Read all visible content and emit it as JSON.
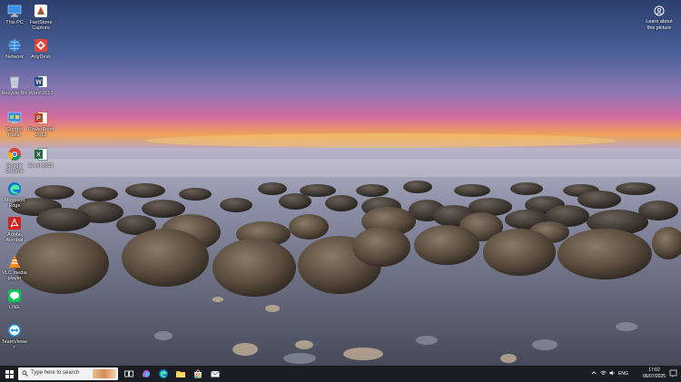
{
  "desktop": {
    "icons": [
      {
        "label": "This PC",
        "icon": "this-pc-icon"
      },
      {
        "label": "FastStone Capture",
        "icon": "faststone-icon"
      },
      {
        "label": "Network",
        "icon": "network-icon"
      },
      {
        "label": "AnyDesk",
        "icon": "anydesk-icon"
      },
      {
        "label": "Recycle Bin",
        "icon": "recycle-bin-icon"
      },
      {
        "label": "Word 2013",
        "icon": "word-icon"
      },
      {
        "label": "Control Panel",
        "icon": "control-panel-icon"
      },
      {
        "label": "PowerPoint 2013",
        "icon": "powerpoint-icon"
      },
      {
        "label": "Google Chrome",
        "icon": "chrome-icon"
      },
      {
        "label": "Excel 2013",
        "icon": "excel-icon"
      },
      {
        "label": "Microsoft Edge",
        "icon": "edge-icon"
      },
      {
        "label": "Adobe Acrobat",
        "icon": "acrobat-icon"
      },
      {
        "label": "VLC media player",
        "icon": "vlc-icon"
      },
      {
        "label": "LINE",
        "icon": "line-icon"
      },
      {
        "label": "TeamViewer",
        "icon": "teamviewer-icon"
      }
    ],
    "learn_label": "Learn about this picture"
  },
  "taskbar": {
    "search_placeholder": "Type here to search",
    "lang": "ENG",
    "time": "17:02",
    "date": "06/07/2025"
  },
  "colors": {
    "taskbar_bg": "#1b1d22",
    "accent": "#3a8ee6"
  }
}
